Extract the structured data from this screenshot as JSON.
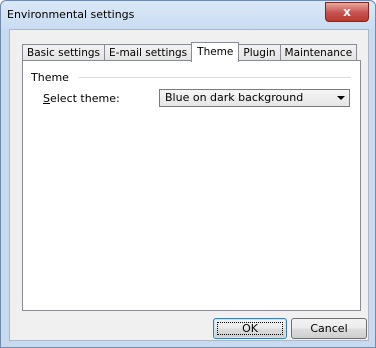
{
  "window": {
    "title": "Environmental settings",
    "close_icon": "close-icon",
    "close_symbol": "x"
  },
  "tabs": [
    {
      "label": "Basic settings",
      "active": false
    },
    {
      "label": "E-mail settings",
      "active": false
    },
    {
      "label": "Theme",
      "active": true
    },
    {
      "label": "Plugin",
      "active": false
    },
    {
      "label": "Maintenance",
      "active": false
    }
  ],
  "theme_group": {
    "label": "Theme",
    "select_label_accel": "S",
    "select_label_rest": "elect theme:",
    "select_value": "Blue on dark background"
  },
  "buttons": {
    "ok": "OK",
    "cancel": "Cancel"
  }
}
